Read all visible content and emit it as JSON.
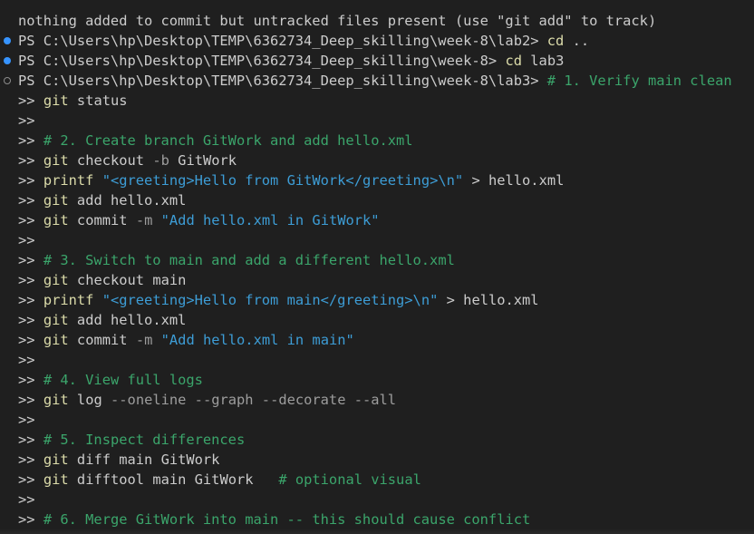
{
  "terminal": {
    "status_line": "nothing added to commit but untracked files present (use \"git add\" to track)",
    "commands": [
      {
        "prompt": "PS C:\\Users\\hp\\Desktop\\TEMP\\6362734_Deep_skilling\\week-8\\lab2>",
        "cmd": "cd",
        "arg": "..",
        "decoration": "success"
      },
      {
        "prompt": "PS C:\\Users\\hp\\Desktop\\TEMP\\6362734_Deep_skilling\\week-8>",
        "cmd": "cd",
        "arg": "lab3",
        "decoration": "success"
      },
      {
        "prompt": "PS C:\\Users\\hp\\Desktop\\TEMP\\6362734_Deep_skilling\\week-8\\lab3>",
        "comment": "# 1. Verify main clean",
        "decoration": "pending"
      }
    ],
    "continuation_prompt": ">>",
    "lines": [
      {
        "git": "git",
        "rest": "status"
      },
      {},
      {
        "comment": "# 2. Create branch GitWork and add hello.xml"
      },
      {
        "git": "git",
        "rest": "checkout",
        "param": "-b",
        "rest2": "GitWork"
      },
      {
        "cmd": "printf",
        "str": "\"<greeting>Hello from GitWork</greeting>\\n\"",
        "rest": "> hello.xml"
      },
      {
        "git": "git",
        "rest": "add hello.xml"
      },
      {
        "git": "git",
        "rest": "commit",
        "param": "-m",
        "str": "\"Add hello.xml in GitWork\""
      },
      {},
      {
        "comment": "# 3. Switch to main and add a different hello.xml"
      },
      {
        "git": "git",
        "rest": "checkout main"
      },
      {
        "cmd": "printf",
        "str": "\"<greeting>Hello from main</greeting>\\n\"",
        "rest": "> hello.xml"
      },
      {
        "git": "git",
        "rest": "add hello.xml"
      },
      {
        "git": "git",
        "rest": "commit",
        "param": "-m",
        "str": "\"Add hello.xml in main\""
      },
      {},
      {
        "comment": "# 4. View full logs"
      },
      {
        "git": "git",
        "rest": "log",
        "param": "--oneline --graph --decorate --all"
      },
      {},
      {
        "comment": "# 5. Inspect differences"
      },
      {
        "git": "git",
        "rest": "diff main GitWork"
      },
      {
        "git": "git",
        "rest": "difftool main GitWork",
        "comment": "# optional visual",
        "gap": "   "
      },
      {},
      {
        "comment": "# 6. Merge GitWork into main -- this should cause conflict"
      }
    ]
  },
  "colors": {
    "background": "#1f1f1f",
    "text": "#cccccc",
    "command": "#dcdcaa",
    "string": "#3d9dd6",
    "parameter": "#9d9d9d",
    "comment": "#3ba56b",
    "decoration_success": "#3794ff",
    "decoration_pending": "#8b8b8b"
  }
}
